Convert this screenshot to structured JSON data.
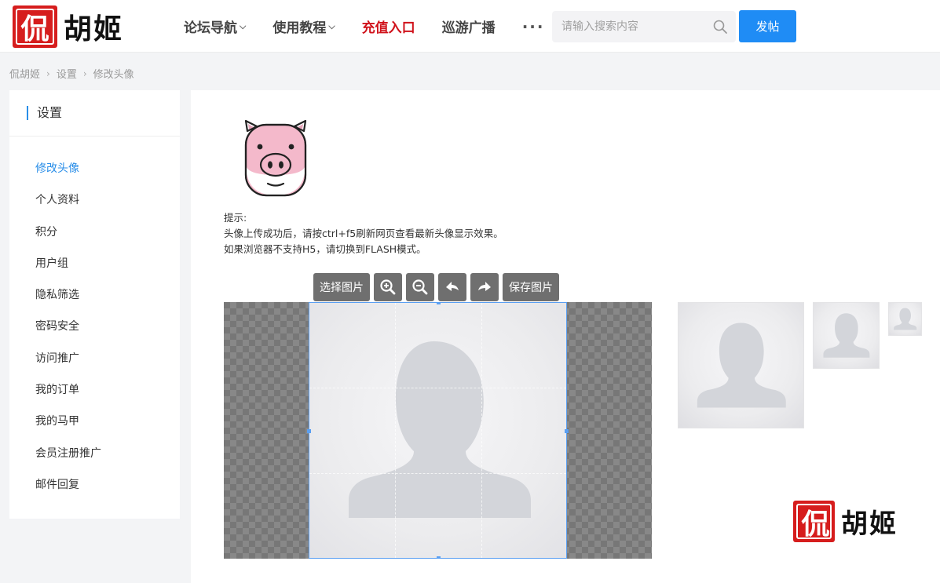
{
  "header": {
    "logo_char": "侃",
    "logo_text": "胡姬",
    "nav": [
      {
        "label": "论坛导航",
        "dropdown": true,
        "highlight": false
      },
      {
        "label": "使用教程",
        "dropdown": true,
        "highlight": false
      },
      {
        "label": "充值入口",
        "dropdown": false,
        "highlight": true
      },
      {
        "label": "巡游广播",
        "dropdown": false,
        "highlight": false
      }
    ],
    "more_label": "···",
    "search_placeholder": "请输入搜索内容",
    "post_button": "发帖"
  },
  "breadcrumb": {
    "items": [
      "侃胡姬",
      "设置",
      "修改头像"
    ],
    "separator": "›"
  },
  "sidebar": {
    "title": "设置",
    "items": [
      {
        "label": "修改头像",
        "active": true
      },
      {
        "label": "个人资料",
        "active": false
      },
      {
        "label": "积分",
        "active": false
      },
      {
        "label": "用户组",
        "active": false
      },
      {
        "label": "隐私筛选",
        "active": false
      },
      {
        "label": "密码安全",
        "active": false
      },
      {
        "label": "访问推广",
        "active": false
      },
      {
        "label": "我的订单",
        "active": false
      },
      {
        "label": "我的马甲",
        "active": false
      },
      {
        "label": "会员注册推广",
        "active": false
      },
      {
        "label": "邮件回复",
        "active": false
      }
    ]
  },
  "main": {
    "tips_title": "提示:",
    "tips_line1": "头像上传成功后，请按ctrl+f5刷新网页查看最新头像显示效果。",
    "tips_line2": "如果浏览器不支持H5，请切换到FLASH模式。",
    "toolbar": {
      "select_label": "选择图片",
      "save_label": "保存图片"
    }
  },
  "watermark": {
    "logo_char": "侃",
    "logo_text": "胡姬"
  },
  "colors": {
    "accent_blue": "#1f8cf5",
    "active_link": "#2a8ee8",
    "highlight_red": "#d0121b",
    "logo_red": "#d61d1d"
  }
}
